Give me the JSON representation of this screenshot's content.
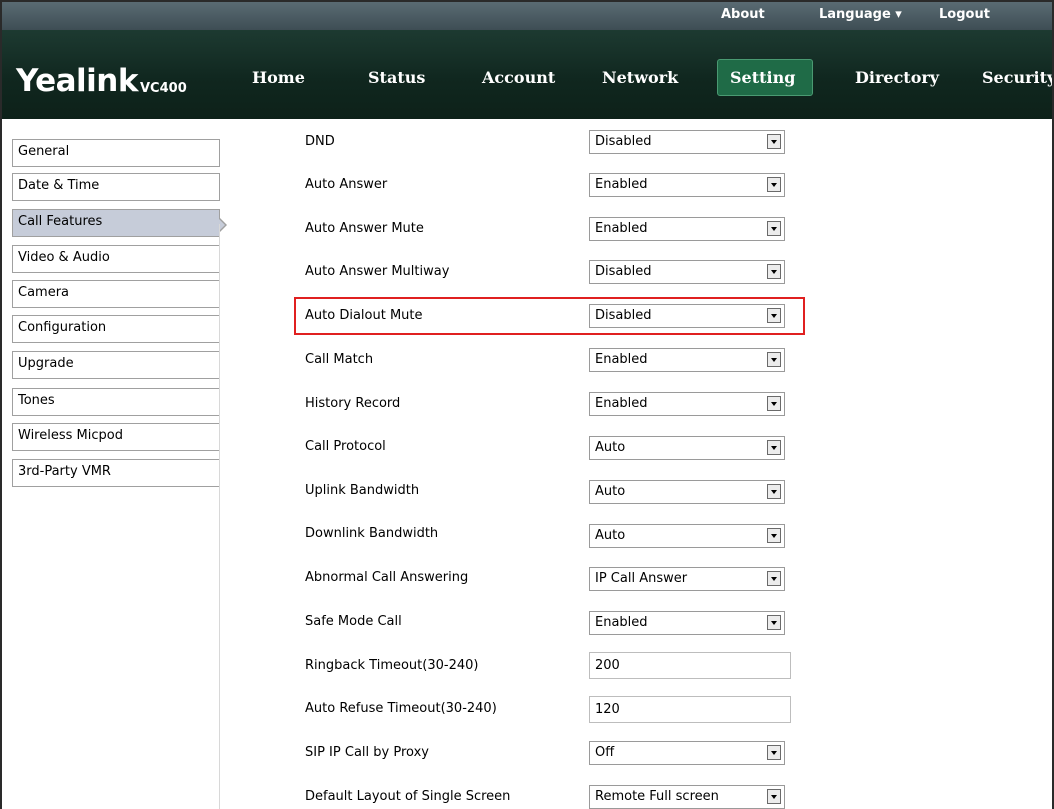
{
  "top_links": {
    "about": "About",
    "language": "Language ▾",
    "logout": "Logout"
  },
  "brand": {
    "logo": "Yealink",
    "model": "VC400"
  },
  "nav": [
    {
      "label": "Home"
    },
    {
      "label": "Status"
    },
    {
      "label": "Account"
    },
    {
      "label": "Network"
    },
    {
      "label": "Setting"
    },
    {
      "label": "Directory"
    },
    {
      "label": "Security"
    }
  ],
  "nav_active": "Setting",
  "sidebar": [
    {
      "label": "General"
    },
    {
      "label": "Date & Time"
    },
    {
      "label": "Call Features"
    },
    {
      "label": "Video & Audio"
    },
    {
      "label": "Camera"
    },
    {
      "label": "Configuration"
    },
    {
      "label": "Upgrade"
    },
    {
      "label": "Tones"
    },
    {
      "label": "Wireless Micpod"
    },
    {
      "label": "3rd-Party VMR"
    }
  ],
  "sidebar_active": "Call Features",
  "fields": [
    {
      "label": "DND",
      "value": "Disabled",
      "kind": "select"
    },
    {
      "label": "Auto Answer",
      "value": "Enabled",
      "kind": "select"
    },
    {
      "label": "Auto Answer Mute",
      "value": "Enabled",
      "kind": "select"
    },
    {
      "label": "Auto Answer Multiway",
      "value": "Disabled",
      "kind": "select"
    },
    {
      "label": "Auto Dialout Mute",
      "value": "Disabled",
      "kind": "select"
    },
    {
      "label": "Call Match",
      "value": "Enabled",
      "kind": "select"
    },
    {
      "label": "History Record",
      "value": "Enabled",
      "kind": "select"
    },
    {
      "label": "Call Protocol",
      "value": "Auto",
      "kind": "select"
    },
    {
      "label": "Uplink Bandwidth",
      "value": "Auto",
      "kind": "select"
    },
    {
      "label": "Downlink Bandwidth",
      "value": "Auto",
      "kind": "select"
    },
    {
      "label": "Abnormal Call Answering",
      "value": "IP Call Answer",
      "kind": "select"
    },
    {
      "label": "Safe Mode Call",
      "value": "Enabled",
      "kind": "select"
    },
    {
      "label": "Ringback Timeout(30-240)",
      "value": "200",
      "kind": "text"
    },
    {
      "label": "Auto Refuse Timeout(30-240)",
      "value": "120",
      "kind": "text"
    },
    {
      "label": "SIP IP Call by Proxy",
      "value": "Off",
      "kind": "select"
    },
    {
      "label": "Default Layout of Single Screen",
      "value": "Remote Full screen",
      "kind": "select"
    }
  ],
  "highlighted_field": "Auto Dialout Mute",
  "colors": {
    "highlight": "#e02020",
    "header_bg": "#10271f",
    "active_tab": "#1f6b47",
    "sidebar_active": "#c6ccd9"
  }
}
